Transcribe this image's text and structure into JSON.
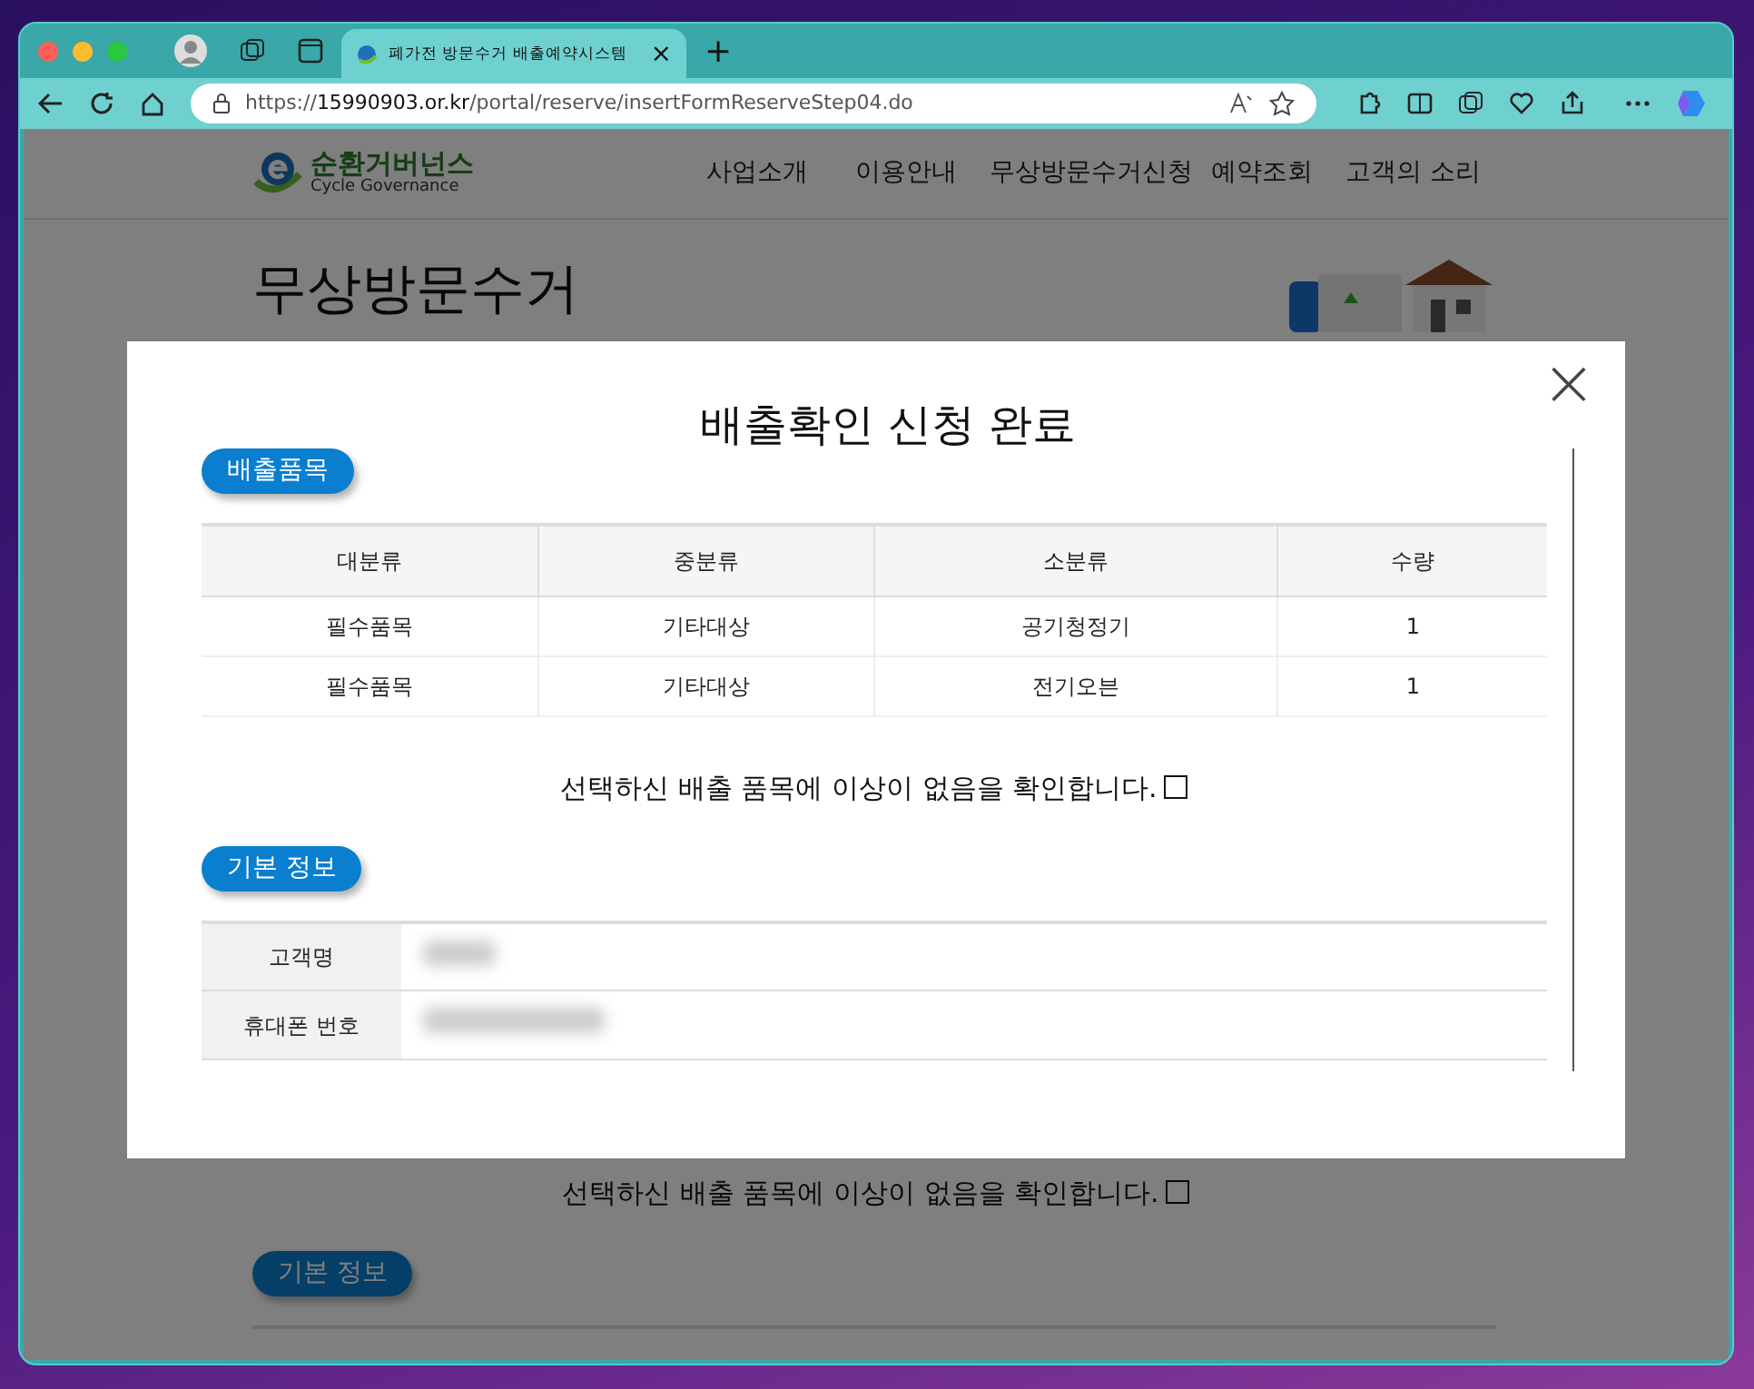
{
  "browser": {
    "tab": {
      "title": "폐가전 방문수거 배출예약시스템",
      "close": "×"
    },
    "new_tab": "+",
    "url": "https://**15990903.or.kr**/portal/reserve/insertFormReserveStep04.do"
  },
  "page": {
    "logo": {
      "name": "순환거버넌스",
      "subtitle": "Cycle Governance"
    },
    "nav": [
      "사업소개",
      "이용안내",
      "무상방문수거신청",
      "예약조회",
      "고객의 소리"
    ],
    "title": "무상방문수거",
    "confirm": {
      "text": "선택하신 배출 품목에 이상이 없음을 확인합니다.",
      "checked": false
    },
    "section_label": "기본 정보"
  },
  "modal": {
    "title": "배출확인 신청 완료",
    "close": "×",
    "items_label": "배출품목",
    "items_table": {
      "columns": [
        "대분류",
        "중분류",
        "소분류",
        "수량"
      ],
      "rows": [
        [
          "필수품목",
          "기타대상",
          "공기청정기",
          "1"
        ],
        [
          "필수품목",
          "기타대상",
          "전기오븐",
          "1"
        ]
      ]
    },
    "confirm": {
      "text": "선택하신 배출 품목에 이상이 없음을 확인합니다.",
      "checked": false
    },
    "info_label": "기본 정보",
    "info_rows": [
      {
        "label": "고객명",
        "redacted": true
      },
      {
        "label": "휴대폰 번호",
        "redacted": true
      }
    ]
  }
}
